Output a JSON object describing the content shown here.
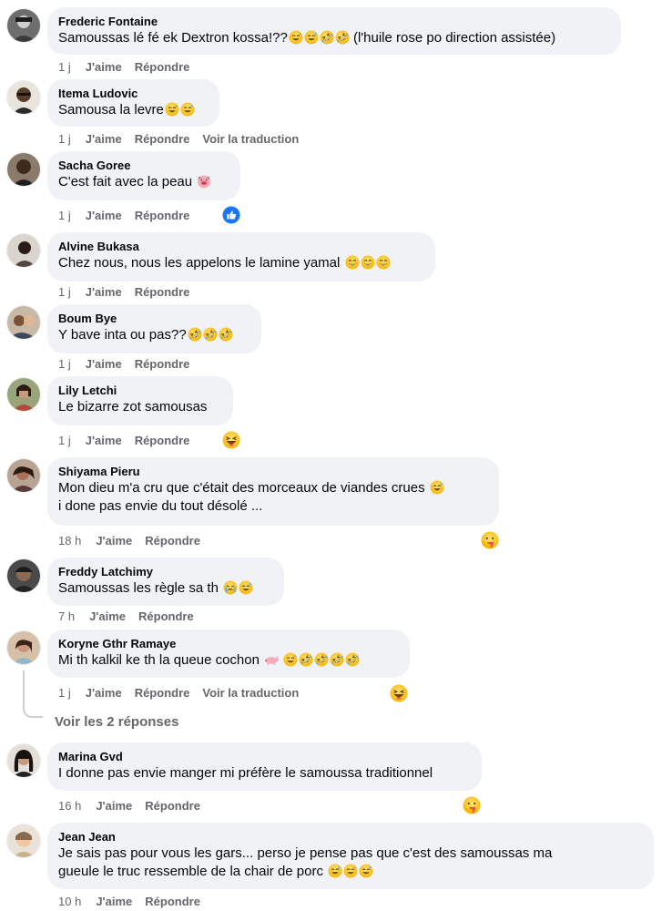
{
  "comments": [
    {
      "author": "Frederic Fontaine",
      "text": "Samoussas lé fé ek Dextron kossa!??",
      "text_tail": "(l'huile rose po direction assistée)",
      "time": "1 j",
      "like": "J'aime",
      "reply": "Répondre"
    },
    {
      "author": "Itema Ludovic",
      "text": "Samousa la levre",
      "time": "1 j",
      "like": "J'aime",
      "reply": "Répondre",
      "translate": "Voir la traduction"
    },
    {
      "author": "Sacha Goree",
      "text": "C'est fait avec la peau",
      "time": "1 j",
      "like": "J'aime",
      "reply": "Répondre"
    },
    {
      "author": "Alvine Bukasa",
      "text": "Chez nous, nous les appelons le lamine yamal",
      "time": "1 j",
      "like": "J'aime",
      "reply": "Répondre"
    },
    {
      "author": "Boum Bye",
      "text": "Y bave inta ou pas??",
      "time": "1 j",
      "like": "J'aime",
      "reply": "Répondre"
    },
    {
      "author": "Lily Letchi",
      "text": "Le bizarre zot samousas",
      "time": "1 j",
      "like": "J'aime",
      "reply": "Répondre"
    },
    {
      "author": "Shiyama Pieru",
      "text": "Mon dieu m'a cru que c'était des morceaux de viandes crues",
      "text2": "i done pas envie du tout désolé ...",
      "time": "18 h",
      "like": "J'aime",
      "reply": "Répondre"
    },
    {
      "author": "Freddy Latchimy",
      "text": "Samoussas les règle sa th",
      "time": "7 h",
      "like": "J'aime",
      "reply": "Répondre"
    },
    {
      "author": "Koryne Gthr Ramaye",
      "text": "Mi th kalkil ke th la queue cochon",
      "time": "1 j",
      "like": "J'aime",
      "reply": "Répondre",
      "translate": "Voir la traduction"
    },
    {
      "author": "Marina Gvd",
      "text": "I donne pas envie manger mi préfère le samoussa traditionnel",
      "time": "16 h",
      "like": "J'aime",
      "reply": "Répondre"
    },
    {
      "author": "Jean Jean",
      "text": "Je sais pas pour vous les gars... perso je pense pas que c'est des samoussas ma",
      "text2": "gueule le truc ressemble de la chair de porc",
      "time": "10 h",
      "like": "J'aime",
      "reply": "Répondre"
    }
  ],
  "replies_link": "Voir les 2 réponses",
  "colors": {
    "bubble": "#f0f2f5",
    "meta": "#65676b",
    "like_blue": "#1877f2",
    "emoji_yellow": "#ffcc4d"
  },
  "icons": [
    "grinning-sweat-emoji",
    "rofl-emoji",
    "pig-face-emoji",
    "laughing-emoji",
    "crying-laughing-emoji",
    "pig-emoji",
    "like-reaction-icon",
    "haha-reaction-icon",
    "care-reaction-icon"
  ]
}
